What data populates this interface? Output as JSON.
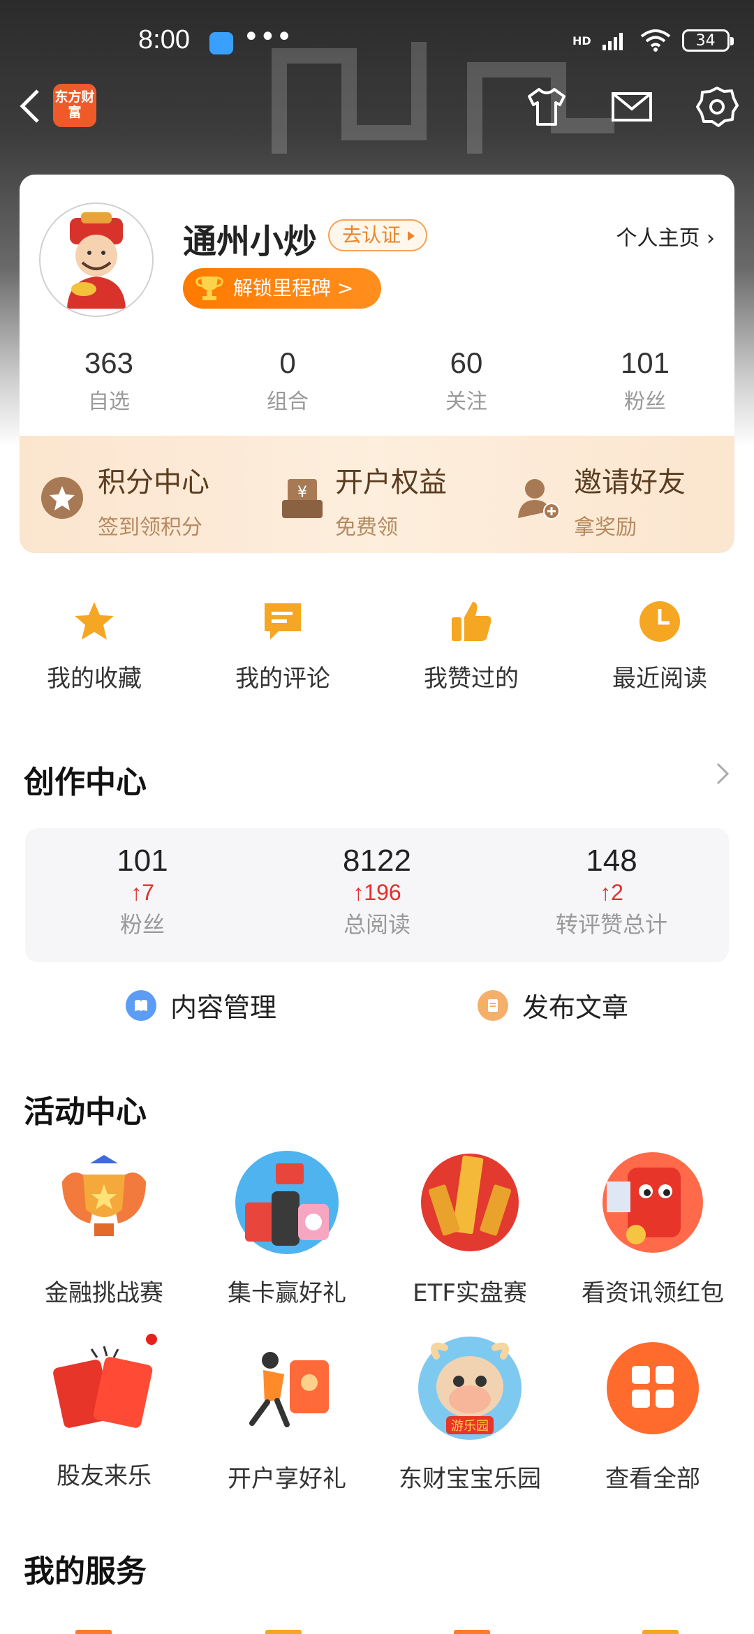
{
  "status_bar": {
    "time": "8:00",
    "dots": "•••",
    "network": "HD",
    "battery": "34"
  },
  "nav": {
    "logo_text": "东方财富"
  },
  "profile": {
    "username": "通州小炒",
    "cert_label": "去认证",
    "home_link": "个人主页 ›",
    "milestone": "解锁里程碑 >",
    "stats": [
      {
        "value": "363",
        "label": "自选"
      },
      {
        "value": "0",
        "label": "组合"
      },
      {
        "value": "60",
        "label": "关注"
      },
      {
        "value": "101",
        "label": "粉丝"
      }
    ]
  },
  "benefits": [
    {
      "title": "积分中心",
      "subtitle": "签到领积分",
      "icon": "star-badge-icon"
    },
    {
      "title": "开户权益",
      "subtitle": "免费领",
      "icon": "yuan-box-icon"
    },
    {
      "title": "邀请好友",
      "subtitle": "拿奖励",
      "icon": "add-user-icon"
    }
  ],
  "quick_links": [
    {
      "label": "我的收藏",
      "icon": "star-icon"
    },
    {
      "label": "我的评论",
      "icon": "comment-icon"
    },
    {
      "label": "我赞过的",
      "icon": "thumbs-up-icon"
    },
    {
      "label": "最近阅读",
      "icon": "clock-icon"
    }
  ],
  "creator": {
    "title": "创作中心",
    "stats": [
      {
        "value": "101",
        "delta": "↑7",
        "label": "粉丝"
      },
      {
        "value": "8122",
        "delta": "↑196",
        "label": "总阅读"
      },
      {
        "value": "148",
        "delta": "↑2",
        "label": "转评赞总计"
      }
    ],
    "actions": [
      {
        "label": "内容管理",
        "color": "#5b9cf5"
      },
      {
        "label": "发布文章",
        "color": "#f4b06a"
      }
    ]
  },
  "activity": {
    "title": "活动中心",
    "row1": [
      {
        "label": "金融挑战赛"
      },
      {
        "label": "集卡赢好礼"
      },
      {
        "label": "ETF实盘赛"
      },
      {
        "label": "看资讯领红包"
      }
    ],
    "row2": [
      {
        "label": "股友来乐"
      },
      {
        "label": "开户享好礼"
      },
      {
        "label": "东财宝宝乐园",
        "badge": "游乐园"
      },
      {
        "label": "查看全部"
      }
    ]
  },
  "services": {
    "title": "我的服务"
  },
  "colors": {
    "accent": "#ff7a00",
    "red": "#e0302f",
    "brand": "#f05a28"
  }
}
